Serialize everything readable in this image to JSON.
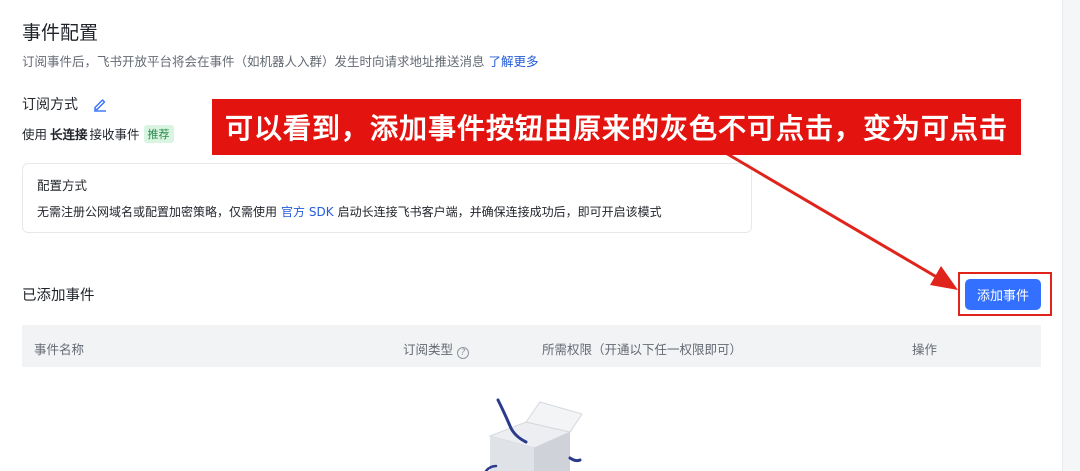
{
  "header": {
    "title": "事件配置",
    "description": "订阅事件后，飞书开放平台将会在事件（如机器人入群）发生时向请求地址推送消息",
    "learn_more": "了解更多"
  },
  "subscription": {
    "label": "订阅方式",
    "method_prefix": "使用",
    "method_name": "长连接",
    "method_suffix": "接收事件",
    "badge": "推荐"
  },
  "config_card": {
    "title": "配置方式",
    "desc_before": "无需注册公网域名或配置加密策略，仅需使用",
    "sdk_link": "官方 SDK",
    "desc_after": "启动长连接飞书客户端，并确保连接成功后，即可开启该模式"
  },
  "events": {
    "title": "已添加事件",
    "add_button": "添加事件",
    "columns": [
      "事件名称",
      "订阅类型",
      "所需权限（开通以下任一权限即可）",
      "操作"
    ]
  },
  "annotation": {
    "callout_text": "可以看到，添加事件按钮由原来的灰色不可点击，变为可点击",
    "color": "#e3140f"
  },
  "colors": {
    "primary": "#3370ff",
    "link": "#245bdb",
    "annotation_red": "#e0241c"
  }
}
